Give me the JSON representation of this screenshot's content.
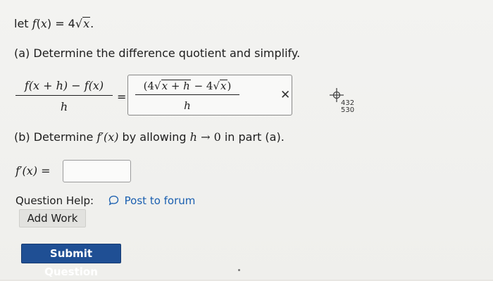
{
  "problem": {
    "prefix": "let ",
    "f": "f",
    "x": "x",
    "equals_4": ") = 4",
    "period": "."
  },
  "part_a": {
    "text": "(a) Determine the difference quotient and simplify.",
    "lhs_numerator": "f(x + h) − f(x)",
    "lhs_denominator": "h",
    "equals": "=",
    "answer": {
      "coef_1": "4",
      "radicand_1": "x + h",
      "minus_4": " − 4",
      "radicand_2": "x",
      "open_paren": "(",
      "close_paren": ")",
      "denominator": "h"
    },
    "status_mark": "✕"
  },
  "cursor_readout": {
    "x": "432",
    "y": "530"
  },
  "part_b": {
    "prefix": "(b) Determine ",
    "fprime_expr": "f′(x)",
    "middle": " by allowing ",
    "h": "h",
    "arrow_zero": " → 0",
    "suffix": " in part (a)."
  },
  "fprime_answer": {
    "label": "f′(x) =",
    "value": ""
  },
  "help": {
    "label": "Question Help:",
    "link": "Post to forum"
  },
  "buttons": {
    "add_work": "Add Work",
    "submit": "Submit Question"
  }
}
